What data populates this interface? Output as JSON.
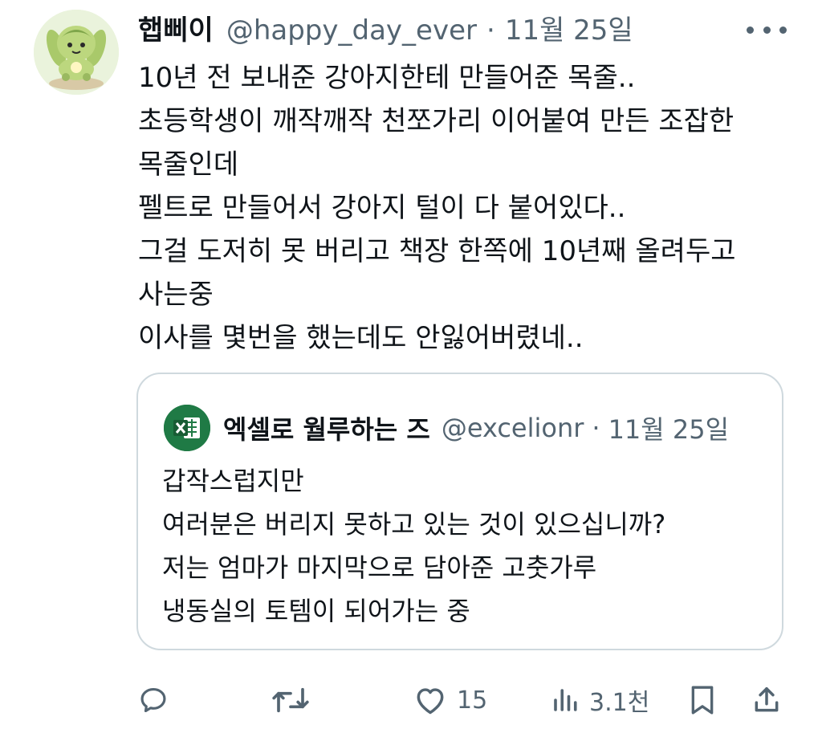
{
  "tweet": {
    "author": {
      "display_name": "햅삐이",
      "handle": "@happy_day_ever"
    },
    "separator": "·",
    "date": "11월 25일",
    "more_icon": "more-horizontal-icon",
    "text_lines": [
      "10년 전 보내준 강아지한테 만들어준 목줄..",
      "초등학생이 깨작깨작 천쪼가리 이어붙여 만든 조잡한",
      "목줄인데",
      "펠트로 만들어서 강아지 털이 다 붙어있다..",
      "그걸 도저히 못 버리고 책장 한쪽에 10년째 올려두고",
      "사는중",
      "이사를 몇번을 했는데도 안잃어버렸네.."
    ]
  },
  "quoted": {
    "author": {
      "display_name": "엑셀로 월루하는 즈",
      "handle": "@excelionr"
    },
    "separator": "·",
    "date": "11월 25일",
    "avatar_icon": "excel-logo-icon",
    "text_lines": [
      "갑작스럽지만",
      "여러분은 버리지 못하고 있는 것이 있으십니까?",
      "저는 엄마가 마지막으로 담아준 고춧가루",
      "냉동실의 토템이 되어가는 중"
    ]
  },
  "actions": {
    "reply": {
      "icon": "reply-icon"
    },
    "retweet": {
      "icon": "retweet-icon"
    },
    "like": {
      "icon": "heart-icon",
      "count": "15"
    },
    "views": {
      "icon": "views-icon",
      "count": "3.1천"
    },
    "bookmark": {
      "icon": "bookmark-icon"
    },
    "share": {
      "icon": "share-icon"
    }
  },
  "colors": {
    "text": "#0f1419",
    "secondary": "#536471",
    "border": "#cfd9de",
    "excel_green": "#1f7a45"
  }
}
